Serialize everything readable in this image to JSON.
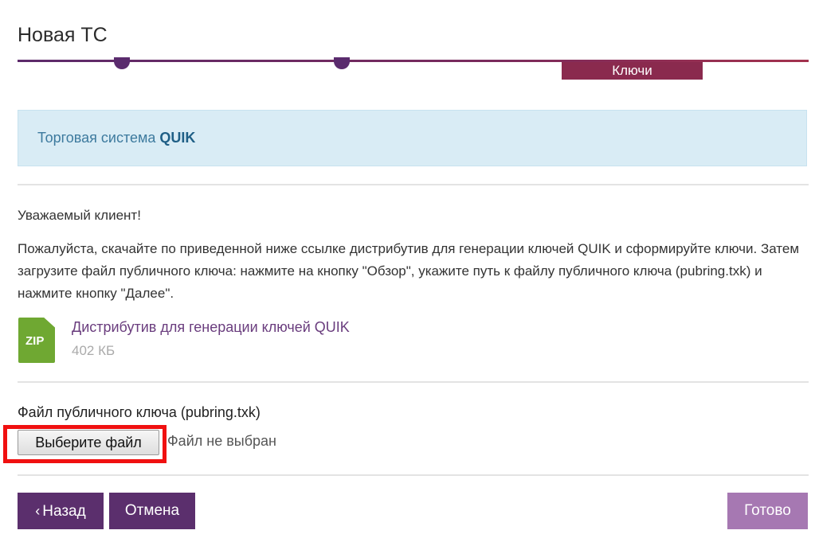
{
  "header": {
    "title": "Новая ТС"
  },
  "stepper": {
    "active_step_label": "Ключи"
  },
  "info": {
    "prefix": "Торговая система ",
    "system": "QUIK"
  },
  "content": {
    "greeting": "Уважаемый клиент!",
    "instructions": "Пожалуйста, скачайте по приведенной ниже ссылке дистрибутив для генерации ключей QUIK и сформируйте ключи. Затем загрузите файл публичного ключа: нажмите на кнопку \"Обзор\", укажите путь к файлу публичного ключа (pubring.txk) и нажмите кнопку \"Далее\"."
  },
  "download": {
    "icon": "zip-file-icon",
    "icon_text": "ZIP",
    "link_text": "Дистрибутив для генерации ключей QUIK",
    "size": "402 КБ"
  },
  "upload": {
    "label": "Файл публичного ключа (pubring.txk)",
    "button_label": "Выберите файл",
    "status": "Файл не выбран"
  },
  "footer": {
    "back_label": "Назад",
    "back_icon": "chevron-left-icon",
    "cancel_label": "Отмена",
    "done_label": "Готово"
  },
  "colors": {
    "brand": "#5b2f6d",
    "active_step": "#8a2a4e",
    "info_bg": "#d9ecf5",
    "done_button": "#a678b2",
    "highlight": "#f01010"
  }
}
